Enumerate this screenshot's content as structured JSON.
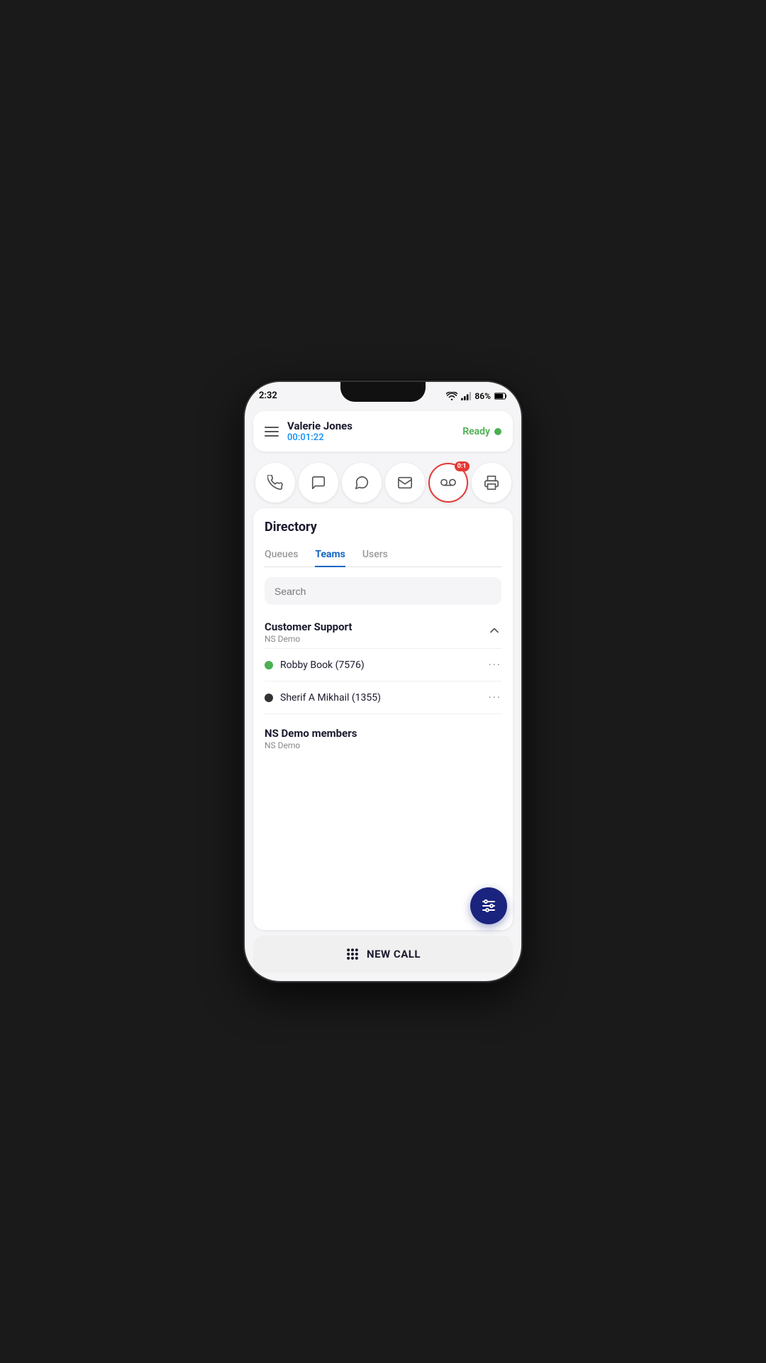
{
  "statusBar": {
    "time": "2:32",
    "battery": "86%"
  },
  "header": {
    "agentName": "Valerie Jones",
    "agentTimer": "00:01:22",
    "statusLabel": "Ready"
  },
  "actionIcons": [
    {
      "id": "phone",
      "label": "Phone",
      "hasBadge": false,
      "badgeText": ""
    },
    {
      "id": "chat",
      "label": "Chat",
      "hasBadge": false,
      "badgeText": ""
    },
    {
      "id": "message",
      "label": "Message",
      "hasBadge": false,
      "badgeText": ""
    },
    {
      "id": "email",
      "label": "Email",
      "hasBadge": false,
      "badgeText": ""
    },
    {
      "id": "voicemail",
      "label": "Voicemail",
      "hasBadge": true,
      "badgeText": "0:1"
    },
    {
      "id": "print",
      "label": "Print",
      "hasBadge": false,
      "badgeText": ""
    }
  ],
  "directory": {
    "title": "Directory",
    "tabs": [
      {
        "id": "queues",
        "label": "Queues",
        "active": false
      },
      {
        "id": "teams",
        "label": "Teams",
        "active": true
      },
      {
        "id": "users",
        "label": "Users",
        "active": false
      }
    ],
    "searchPlaceholder": "Search",
    "teamGroups": [
      {
        "id": "customer-support",
        "name": "Customer Support",
        "sub": "NS Demo",
        "expanded": true,
        "members": [
          {
            "id": "robby-book",
            "name": "Robby Book (7576)",
            "presence": "online"
          },
          {
            "id": "sherif-mikhail",
            "name": "Sherif A Mikhail (1355)",
            "presence": "offline"
          }
        ]
      },
      {
        "id": "ns-demo-members",
        "name": "NS Demo members",
        "sub": "NS Demo",
        "expanded": false,
        "members": []
      }
    ]
  },
  "newCallLabel": "NEW CALL"
}
